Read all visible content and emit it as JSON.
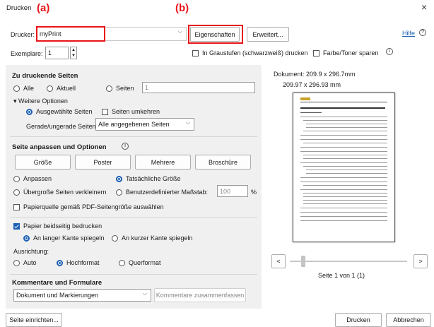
{
  "window": {
    "title": "Drucken",
    "close": "×"
  },
  "annotations": {
    "a": "(a)",
    "b": "(b)"
  },
  "printer": {
    "label": "Drucker:",
    "value": "myPrint",
    "properties_button": "Eigenschaften",
    "advanced_button": "Erweitert...",
    "help_link": "Hilfe"
  },
  "copies": {
    "label": "Exemplare:",
    "value": "1"
  },
  "options": {
    "grayscale": "In Graustufen (schwarzweiß) drucken",
    "save_ink": "Farbe/Toner sparen"
  },
  "pages": {
    "heading": "Zu druckende Seiten",
    "all": "Alle",
    "current": "Aktuell",
    "pages": "Seiten",
    "pages_value": "1",
    "more_options": "Weitere Optionen",
    "selected_pages": "Ausgewählte Seiten",
    "reverse": "Seiten umkehren",
    "even_odd_label": "Gerade/ungerade Seiten:",
    "even_odd_value": "Alle angegebenen Seiten"
  },
  "sizing": {
    "heading": "Seite anpassen und Optionen",
    "buttons": [
      "Größe",
      "Poster",
      "Mehrere",
      "Broschüre"
    ],
    "fit": "Anpassen",
    "actual": "Tatsächliche Größe",
    "shrink": "Übergroße Seiten verkleinern",
    "custom_scale": "Benutzerdefinierter Maßstab:",
    "scale_value": "100",
    "scale_unit": "%",
    "pdf_paper": "Papierquelle gemäß PDF-Seitengröße auswählen"
  },
  "duplex": {
    "label": "Papier beidseitig bedrucken",
    "long_edge": "An langer Kante spiegeln",
    "short_edge": "An kurzer Kante spiegeln"
  },
  "orientation": {
    "label": "Ausrichtung:",
    "auto": "Auto",
    "portrait": "Hochformat",
    "landscape": "Querformat"
  },
  "comments": {
    "heading": "Kommentare und Formulare",
    "value": "Dokument und Markierungen",
    "summarize": "Kommentare zusammenfassen"
  },
  "preview": {
    "document_size": "Dokument: 209.9 x 296.7mm",
    "page_size": "209.97 x 296.93 mm",
    "page_indicator": "Seite 1 von 1 (1)",
    "prev": "<",
    "next": ">"
  },
  "footer": {
    "page_setup": "Seite einrichten...",
    "print": "Drucken",
    "cancel": "Abbrechen"
  },
  "colors": {
    "accent": "#1a5fb4",
    "annotation": "#e8141a",
    "panel": "#f0f0f0"
  }
}
